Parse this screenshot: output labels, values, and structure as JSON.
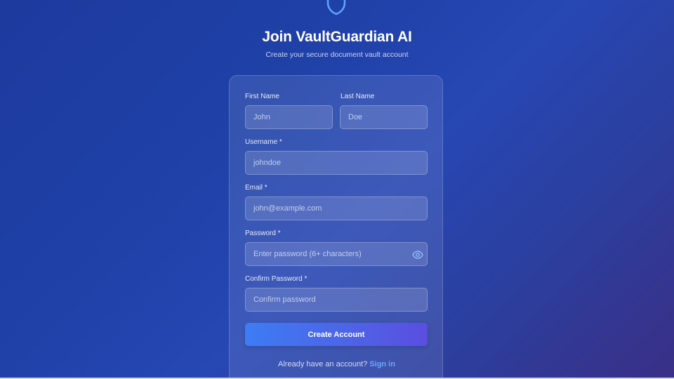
{
  "header": {
    "title": "Join VaultGuardian AI",
    "subtitle": "Create your secure document vault account",
    "logo_icon": "shield-icon"
  },
  "form": {
    "first_name": {
      "label": "First Name",
      "placeholder": "John",
      "value": ""
    },
    "last_name": {
      "label": "Last Name",
      "placeholder": "Doe",
      "value": ""
    },
    "username": {
      "label": "Username *",
      "placeholder": "johndoe",
      "value": ""
    },
    "email": {
      "label": "Email *",
      "placeholder": "john@example.com",
      "value": ""
    },
    "password": {
      "label": "Password *",
      "placeholder": "Enter password (6+ characters)",
      "value": "",
      "toggle_icon": "eye-icon"
    },
    "confirm_password": {
      "label": "Confirm Password *",
      "placeholder": "Confirm password",
      "value": ""
    },
    "submit_label": "Create Account"
  },
  "footer": {
    "prompt": "Already have an account?",
    "link_label": "Sign in"
  },
  "colors": {
    "background_start": "#1d3a9e",
    "background_end": "#3a2f86",
    "button_start": "#3d7cf4",
    "button_end": "#5a4ee0",
    "link": "#6aa6ff",
    "icon_accent": "#5fa0ff"
  }
}
